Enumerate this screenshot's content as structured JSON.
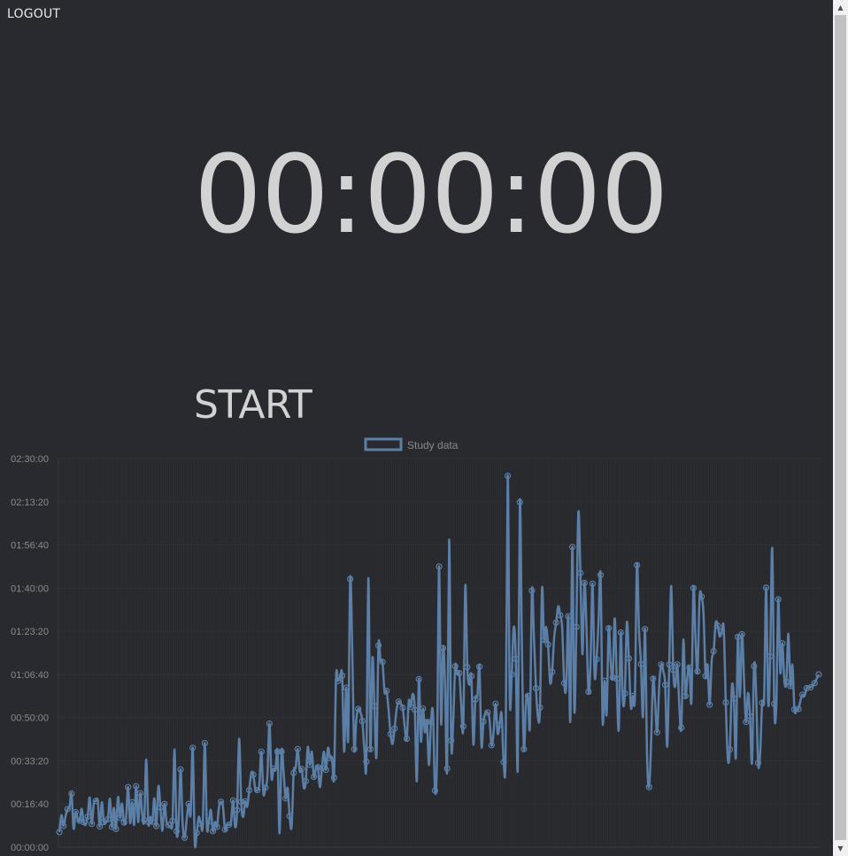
{
  "header": {
    "logout_label": "LOGOUT"
  },
  "timer": {
    "display": "00:00:00"
  },
  "controls": {
    "start_label": "START"
  },
  "colors": {
    "background": "#292a2f",
    "text": "#d2d2d2",
    "series": "#5b7fa6",
    "grid": "#303136",
    "tick_text": "#8a8a8a"
  },
  "chart_data": {
    "type": "line",
    "legend": {
      "position": "top"
    },
    "grid": true,
    "ylim": [
      0,
      9000
    ],
    "y_ticks": [
      {
        "value": 0,
        "label": "00:00:00"
      },
      {
        "value": 1000,
        "label": "00:16:40"
      },
      {
        "value": 2000,
        "label": "00:33:20"
      },
      {
        "value": 3000,
        "label": "00:50:00"
      },
      {
        "value": 4000,
        "label": "01:06:40"
      },
      {
        "value": 5000,
        "label": "01:23:20"
      },
      {
        "value": 6000,
        "label": "01:40:00"
      },
      {
        "value": 7000,
        "label": "01:56:40"
      },
      {
        "value": 8000,
        "label": "02:13:20"
      },
      {
        "value": 9000,
        "label": "02:30:00"
      }
    ],
    "series": [
      {
        "name": "Study data",
        "color": "#5b7fa6",
        "values": [
          350,
          740,
          490,
          710,
          880,
          930,
          1240,
          430,
          810,
          660,
          610,
          890,
          580,
          520,
          710,
          1150,
          540,
          1000,
          1070,
          1080,
          480,
          1040,
          580,
          590,
          650,
          1120,
          470,
          910,
          420,
          1160,
          680,
          1010,
          570,
          670,
          1390,
          560,
          1040,
          520,
          1410,
          580,
          1250,
          770,
          630,
          2030,
          580,
          700,
          590,
          1130,
          490,
          1410,
          920,
          380,
          1000,
          600,
          510,
          480,
          610,
          2260,
          370,
          590,
          1800,
          560,
          220,
          630,
          1000,
          770,
          2300,
          130,
          330,
          700,
          540,
          530,
          2410,
          490,
          600,
          860,
          370,
          580,
          470,
          920,
          1050,
          940,
          410,
          520,
          520,
          580,
          1080,
          470,
          860,
          2510,
          1050,
          700,
          1060,
          940,
          1320,
          1710,
          1680,
          1340,
          1320,
          1450,
          2210,
          1250,
          1380,
          1650,
          2860,
          1610,
          1820,
          1790,
          2210,
          320,
          2210,
          1750,
          1130,
          1370,
          720,
          480,
          1720,
          1840,
          2270,
          1760,
          1810,
          1380,
          1530,
          2320,
          1910,
          2210,
          1630,
          1810,
          1850,
          1390,
          1830,
          2210,
          1790,
          2300,
          2060,
          2060,
          1610,
          3940,
          3850,
          3930,
          3970,
          2210,
          3690,
          2510,
          6210,
          4580,
          2270,
          2950,
          3200,
          3130,
          2920,
          2280,
          1980,
          6230,
          2270,
          4380,
          3270,
          2100,
          4670,
          4310,
          4290,
          3590,
          3620,
          3180,
          2620,
          2390,
          2750,
          3200,
          3370,
          3320,
          3230,
          2790,
          2510,
          3380,
          3250,
          3550,
          3180,
          1530,
          3890,
          2450,
          3210,
          2660,
          2900,
          1900,
          2900,
          3100,
          1310,
          2120,
          6500,
          2880,
          4610,
          3720,
          1820,
          7120,
          2470,
          2890,
          4190,
          4000,
          4030,
          3290,
          2800,
          6050,
          4170,
          3760,
          3960,
          2380,
          3420,
          3510,
          4180,
          2350,
          2910,
          3100,
          3120,
          2960,
          2360,
          2660,
          3320,
          2640,
          2830,
          3090,
          1970,
          2280,
          8600,
          3490,
          4000,
          5100,
          4360,
          1850,
          7990,
          4800,
          2270,
          3300,
          3500,
          2810,
          5940,
          4870,
          3680,
          3000,
          3230,
          5990,
          4800,
          5100,
          4690,
          3820,
          4060,
          4850,
          5200,
          5580,
          5370,
          5060,
          3800,
          3740,
          5350,
          2920,
          6950,
          3160,
          5100,
          7750,
          6350,
          4470,
          6120,
          5100,
          3600,
          4260,
          6100,
          4000,
          4350,
          5240,
          6300,
          2920,
          3850,
          3080,
          5070,
          4280,
          3930,
          5300,
          3900,
          2720,
          4970,
          3410,
          3560,
          5200,
          4370,
          3240,
          3500,
          3500,
          6530,
          5050,
          4240,
          3020,
          5050,
          2160,
          1390,
          2400,
          3900,
          3360,
          2660,
          3720,
          4230,
          4080,
          3760,
          2330,
          4230,
          6050,
          4100,
          3720,
          4230,
          3260,
          2770,
          4800,
          3500,
          3950,
          4160,
          3380,
          6000,
          4830,
          4070,
          5760,
          5800,
          5390,
          3960,
          4220,
          3300,
          4300,
          4540,
          5190,
          5130,
          4880,
          5000,
          5060,
          3350,
          2050,
          2260,
          3700,
          3440,
          2080,
          4870,
          3480,
          4930,
          3920,
          2900,
          3570,
          3030,
          1960,
          4190,
          3620,
          1950,
          2160,
          3340,
          3480,
          6010,
          3330,
          4420,
          6920,
          3320,
          3240,
          5740,
          4050,
          4720,
          3870,
          3830,
          4940,
          3730,
          4220,
          3190,
          3170,
          3200,
          3400,
          3530,
          3500,
          3680,
          3720,
          3700,
          3740,
          3800,
          3900,
          4000
        ]
      }
    ]
  }
}
